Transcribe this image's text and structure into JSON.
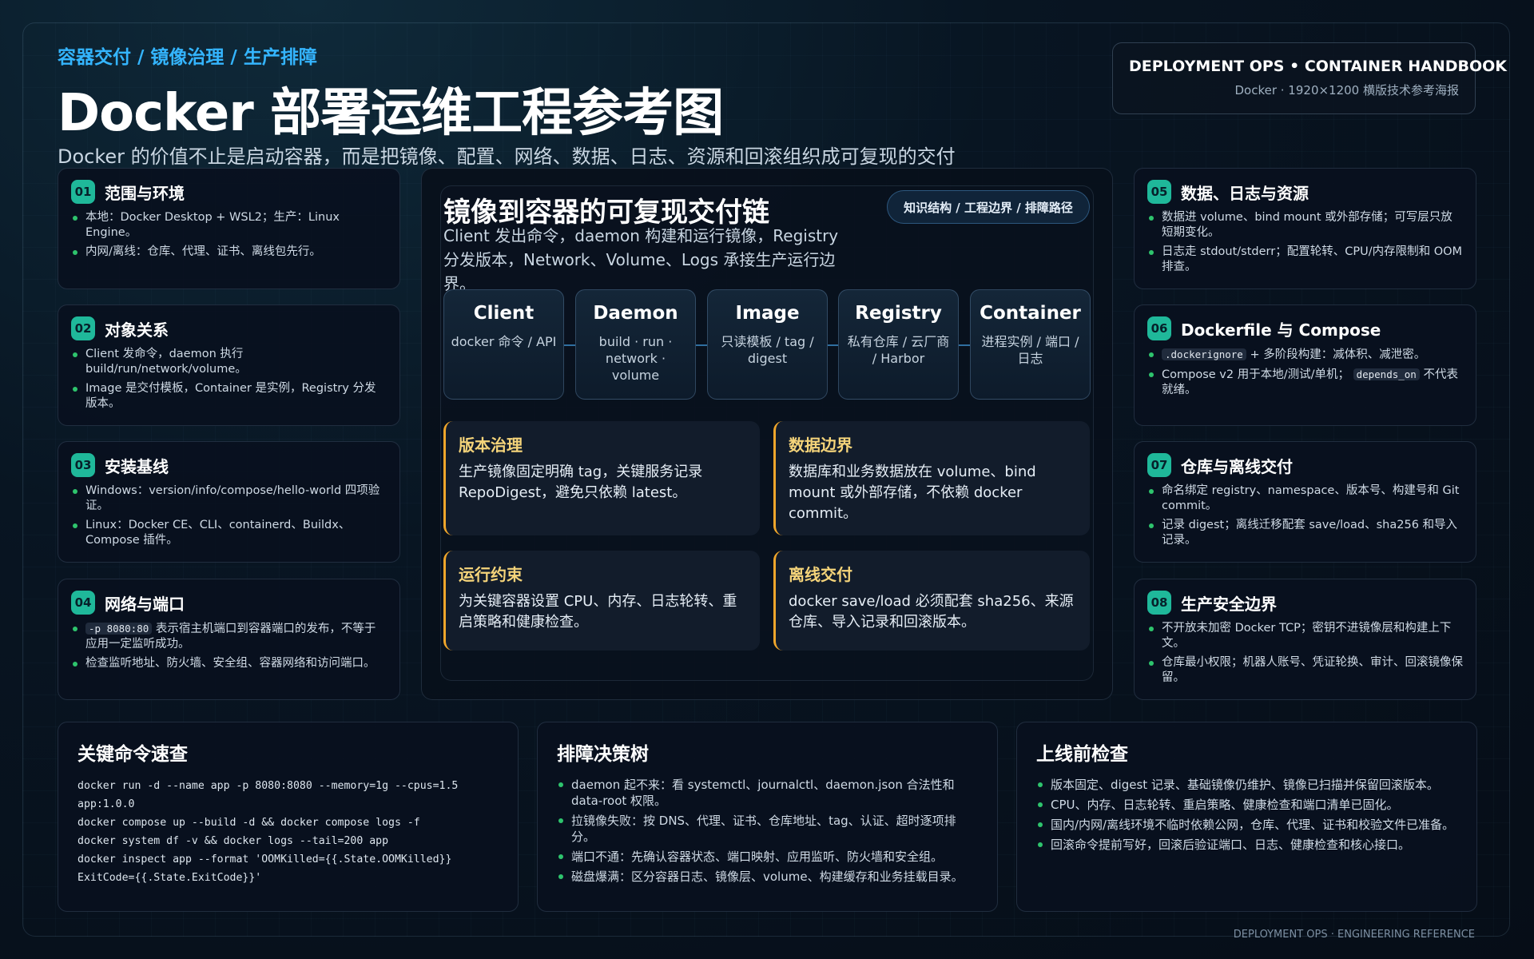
{
  "header": {
    "kicker": "容器交付 / 镜像治理 / 生产排障",
    "title": "Docker 部署运维工程参考图",
    "subtitle": "Docker 的价值不止是启动容器，而是把镜像、配置、网络、数据、日志、资源和回滚组织成可复现的交付"
  },
  "badge": {
    "title": "DEPLOYMENT OPS • CONTAINER HANDBOOK",
    "sub": "Docker · 1920×1200 横版技术参考海报"
  },
  "left_cards": [
    {
      "num": "01",
      "title": "范围与环境",
      "items": [
        "本地：Docker Desktop + WSL2；生产：Linux Engine。",
        "内网/离线：仓库、代理、证书、离线包先行。"
      ]
    },
    {
      "num": "02",
      "title": "对象关系",
      "items": [
        "Client 发命令，daemon 执行 build/run/network/volume。",
        "Image 是交付模板，Container 是实例，Registry 分发版本。"
      ]
    },
    {
      "num": "03",
      "title": "安装基线",
      "items": [
        "Windows：version/info/compose/hello-world 四项验证。",
        "Linux：Docker CE、CLI、containerd、Buildx、Compose 插件。"
      ]
    },
    {
      "num": "04",
      "title": "网络与端口",
      "items": [
        "表示宿主机端口到容器端口的发布，不等于应用一定监听成功。",
        "检查监听地址、防火墙、安全组、容器网络和访问端口。"
      ],
      "code": "-p 8080:80"
    }
  ],
  "right_cards": [
    {
      "num": "05",
      "title": "数据、日志与资源",
      "items": [
        "数据进 volume、bind mount 或外部存储；可写层只放短期变化。",
        "日志走 stdout/stderr；配置轮转、CPU/内存限制和 OOM 排查。"
      ]
    },
    {
      "num": "06",
      "title": "Dockerfile 与 Compose",
      "items": [
        "+ 多阶段构建：减体积、减泄密。",
        "Compose v2 用于本地/测试/单机；",
        "不代表就绪。"
      ],
      "code1": ".dockerignore",
      "code2": "depends_on"
    },
    {
      "num": "07",
      "title": "仓库与离线交付",
      "items": [
        "命名绑定 registry、namespace、版本号、构建号和 Git commit。",
        "记录 digest；离线迁移配套 save/load、sha256 和导入记录。"
      ]
    },
    {
      "num": "08",
      "title": "生产安全边界",
      "items": [
        "不开放未加密 Docker TCP；密钥不进镜像层和构建上下文。",
        "仓库最小权限；机器人账号、凭证轮换、审计、回滚镜像保留。"
      ]
    }
  ],
  "center": {
    "title": "镜像到容器的可复现交付链",
    "tag": "知识结构 / 工程边界 / 排障路径",
    "desc": "Client 发出命令，daemon 构建和运行镜像，Registry 分发版本，Network、Volume、Logs 承接生产运行边界。",
    "nodes": [
      {
        "name": "Client",
        "desc": "docker 命令 / API"
      },
      {
        "name": "Daemon",
        "desc": "build · run · network · volume"
      },
      {
        "name": "Image",
        "desc": "只读模板 / tag / digest"
      },
      {
        "name": "Registry",
        "desc": "私有仓库 / 云厂商 / Harbor"
      },
      {
        "name": "Container",
        "desc": "进程实例 / 端口 / 日志"
      }
    ],
    "panels": [
      {
        "title": "版本治理",
        "text": "生产镜像固定明确 tag，关键服务记录 RepoDigest，避免只依赖 latest。"
      },
      {
        "title": "数据边界",
        "text": "数据库和业务数据放在 volume、bind mount 或外部存储，不依赖 docker commit。"
      },
      {
        "title": "运行约束",
        "text": "为关键容器设置 CPU、内存、日志轮转、重启策略和健康检查。"
      },
      {
        "title": "离线交付",
        "text": "docker save/load 必须配套 sha256、来源仓库、导入记录和回滚版本。"
      }
    ]
  },
  "bottom": {
    "commands": {
      "title": "关键命令速查",
      "lines": [
        "docker run -d --name app -p 8080:8080 --memory=1g --cpus=1.5",
        "app:1.0.0",
        "docker compose up --build -d && docker compose logs -f",
        "docker system df -v && docker logs --tail=200 app",
        "docker inspect app --format 'OOMKilled={{.State.OOMKilled}}",
        "ExitCode={{.State.ExitCode}}'"
      ]
    },
    "troubleshoot": {
      "title": "排障决策树",
      "items": [
        "daemon 起不来：看 systemctl、journalctl、daemon.json 合法性和 data-root 权限。",
        "拉镜像失败：按 DNS、代理、证书、仓库地址、tag、认证、超时逐项排分。",
        "端口不通：先确认容器状态、端口映射、应用监听、防火墙和安全组。",
        "磁盘爆满：区分容器日志、镜像层、volume、构建缓存和业务挂载目录。"
      ]
    },
    "checklist": {
      "title": "上线前检查",
      "items": [
        "版本固定、digest 记录、基础镜像仍维护、镜像已扫描并保留回滚版本。",
        "CPU、内存、日志轮转、重启策略、健康检查和端口清单已固化。",
        "国内/内网/离线环境不临时依赖公网，仓库、代理、证书和校验文件已准备。",
        "回滚命令提前写好，回滚后验证端口、日志、健康检查和核心接口。"
      ]
    }
  },
  "footer": "DEPLOYMENT OPS · ENGINEERING REFERENCE"
}
